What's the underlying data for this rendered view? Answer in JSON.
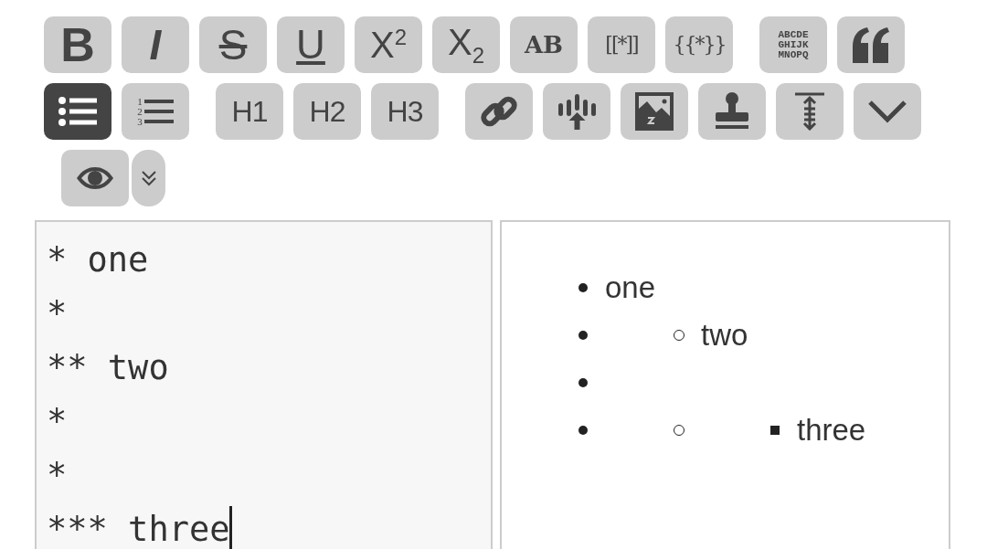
{
  "toolbar": {
    "rows": [
      {
        "groups": [
          {
            "buttons": [
              {
                "kind": "bold",
                "label": "B",
                "active": false
              },
              {
                "kind": "italic",
                "label": "I",
                "active": false
              },
              {
                "kind": "strike",
                "label": "S",
                "active": false
              },
              {
                "kind": "underline",
                "label": "U",
                "active": false
              },
              {
                "kind": "rich",
                "label": "X$^{2}$",
                "active": false
              },
              {
                "kind": "rich",
                "label": "X$_{2}$",
                "active": false
              },
              {
                "kind": "slab",
                "label": "AB",
                "active": false
              },
              {
                "kind": "mono",
                "label": "[[*]]",
                "active": false
              },
              {
                "kind": "mono",
                "label": "{{*}}",
                "active": false
              }
            ]
          },
          {
            "buttons": [
              {
                "kind": "lines",
                "lines": [
                  "ABCDE",
                  "GHIJK",
                  "MNOPQ"
                ],
                "active": false
              },
              {
                "kind": "quote",
                "active": false
              }
            ]
          }
        ]
      },
      {
        "groups": [
          {
            "buttons": [
              {
                "kind": "bullets",
                "active": true
              },
              {
                "kind": "numbers",
                "numbers": [
                  "1",
                  "2",
                  "3"
                ],
                "active": false
              }
            ]
          },
          {
            "buttons": [
              {
                "kind": "heading",
                "label": "H1",
                "active": false
              },
              {
                "kind": "heading",
                "label": "H2",
                "active": false
              },
              {
                "kind": "heading",
                "label": "H3",
                "active": false
              }
            ]
          },
          {
            "buttons": [
              {
                "kind": "link",
                "active": false
              },
              {
                "kind": "upload",
                "active": false
              },
              {
                "kind": "image",
                "active": false
              },
              {
                "kind": "stamp",
                "active": false
              },
              {
                "kind": "spacing",
                "active": false
              },
              {
                "kind": "chevron",
                "active": false
              }
            ]
          }
        ]
      },
      {
        "groups": [
          {
            "buttons": [
              {
                "kind": "eye",
                "active": false
              },
              {
                "kind": "more",
                "active": false
              }
            ]
          }
        ]
      }
    ]
  },
  "editor": {
    "lines": [
      "* one",
      "*",
      "** two",
      "*",
      "*",
      "*** three"
    ]
  },
  "preview": {
    "items": [
      {
        "kind": "text",
        "text": "one"
      },
      {
        "kind": "nested",
        "children": [
          {
            "kind": "text",
            "text": "two"
          }
        ]
      },
      {
        "kind": "empty"
      },
      {
        "kind": "nested",
        "children": [
          {
            "kind": "nested",
            "children": [
              {
                "kind": "text",
                "text": "three"
              }
            ]
          }
        ]
      }
    ]
  }
}
